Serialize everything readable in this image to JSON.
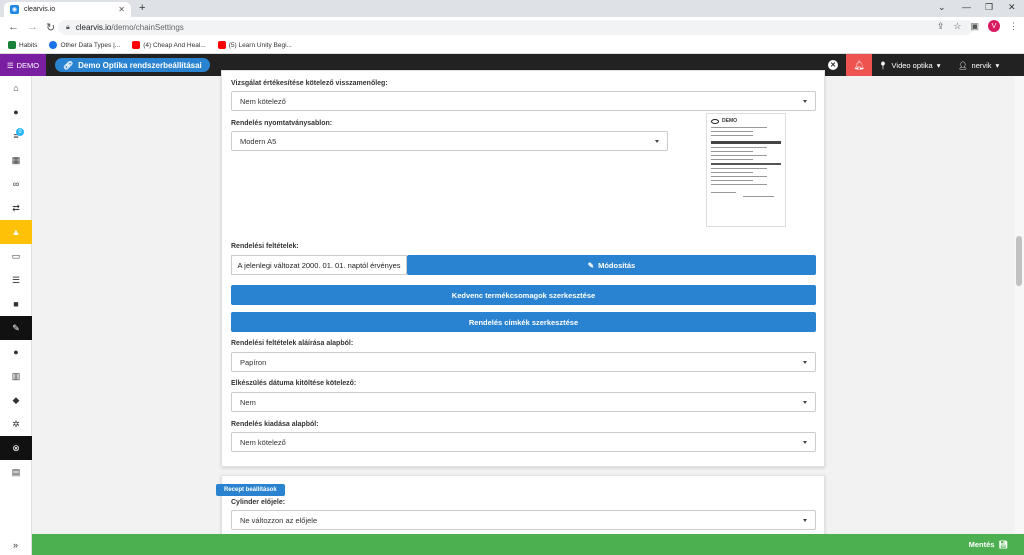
{
  "browser": {
    "tab_title": "clearvis.io",
    "url_host": "clearvis.io",
    "url_path": "/demo/chainSettings",
    "profile_initial": "V",
    "bookmarks": [
      {
        "label": "Habits",
        "color": "#188038"
      },
      {
        "label": "Other Data Types |...",
        "color": "#1a73e8"
      },
      {
        "label": "(4) Cheap And Heal...",
        "color": "#ff0000"
      },
      {
        "label": "(5) Learn Unity Begi...",
        "color": "#ff0000"
      }
    ]
  },
  "header": {
    "demo_label": "DEMO",
    "page_title": "Demo Optika rendszerbeállításai",
    "shop_label": "Video optika",
    "user_label": "nervik"
  },
  "sidebar": {
    "badge_count": "0",
    "icons": [
      "home-icon",
      "user-icon",
      "list-icon",
      "calendar-icon",
      "glasses-icon",
      "repeat-icon",
      "shop-icon",
      "money-icon",
      "menu-icon",
      "briefcase-icon",
      "wrench-icon",
      "person-icon",
      "building-icon",
      "tag-icon",
      "gear-icon",
      "close-icon",
      "archive-icon"
    ]
  },
  "order_settings": {
    "exam_finalize_label": "Vizsgálat értékesítése kötelező visszamenőleg:",
    "exam_finalize_value": "Nem kötelező",
    "print_template_label": "Rendelés nyomtatványsablon:",
    "print_template_value": "Modern A5",
    "terms_label": "Rendelési feltételek:",
    "terms_version": "A jelenlegi változat 2000. 01. 01. naptól érvényes",
    "modify_button": "Módosítás",
    "favorite_button": "Kedvenc termékcsomagok szerkesztése",
    "labels_button": "Rendelés címkék szerkesztése",
    "sign_label": "Rendelési feltételek aláírása alapból:",
    "sign_value": "Papíron",
    "due_date_label": "Elkészülés dátuma kitöltése kötelező:",
    "due_date_value": "Nem",
    "issue_label": "Rendelés kiadása alapból:",
    "issue_value": "Nem kötelező"
  },
  "receipt_preview": {
    "brand": "DEMO"
  },
  "receipt_settings": {
    "section_tag": "Recept beállítások",
    "cylinder_label": "Cylinder előjele:",
    "cylinder_value": "Ne változzon az előjele"
  },
  "footer": {
    "save_label": "Mentés"
  },
  "colors": {
    "primary": "#2a83d0",
    "demo_purple": "#7b1fa2",
    "alert_red": "#ef5350",
    "save_green": "#4caf50",
    "active_yellow": "#ffc107"
  }
}
